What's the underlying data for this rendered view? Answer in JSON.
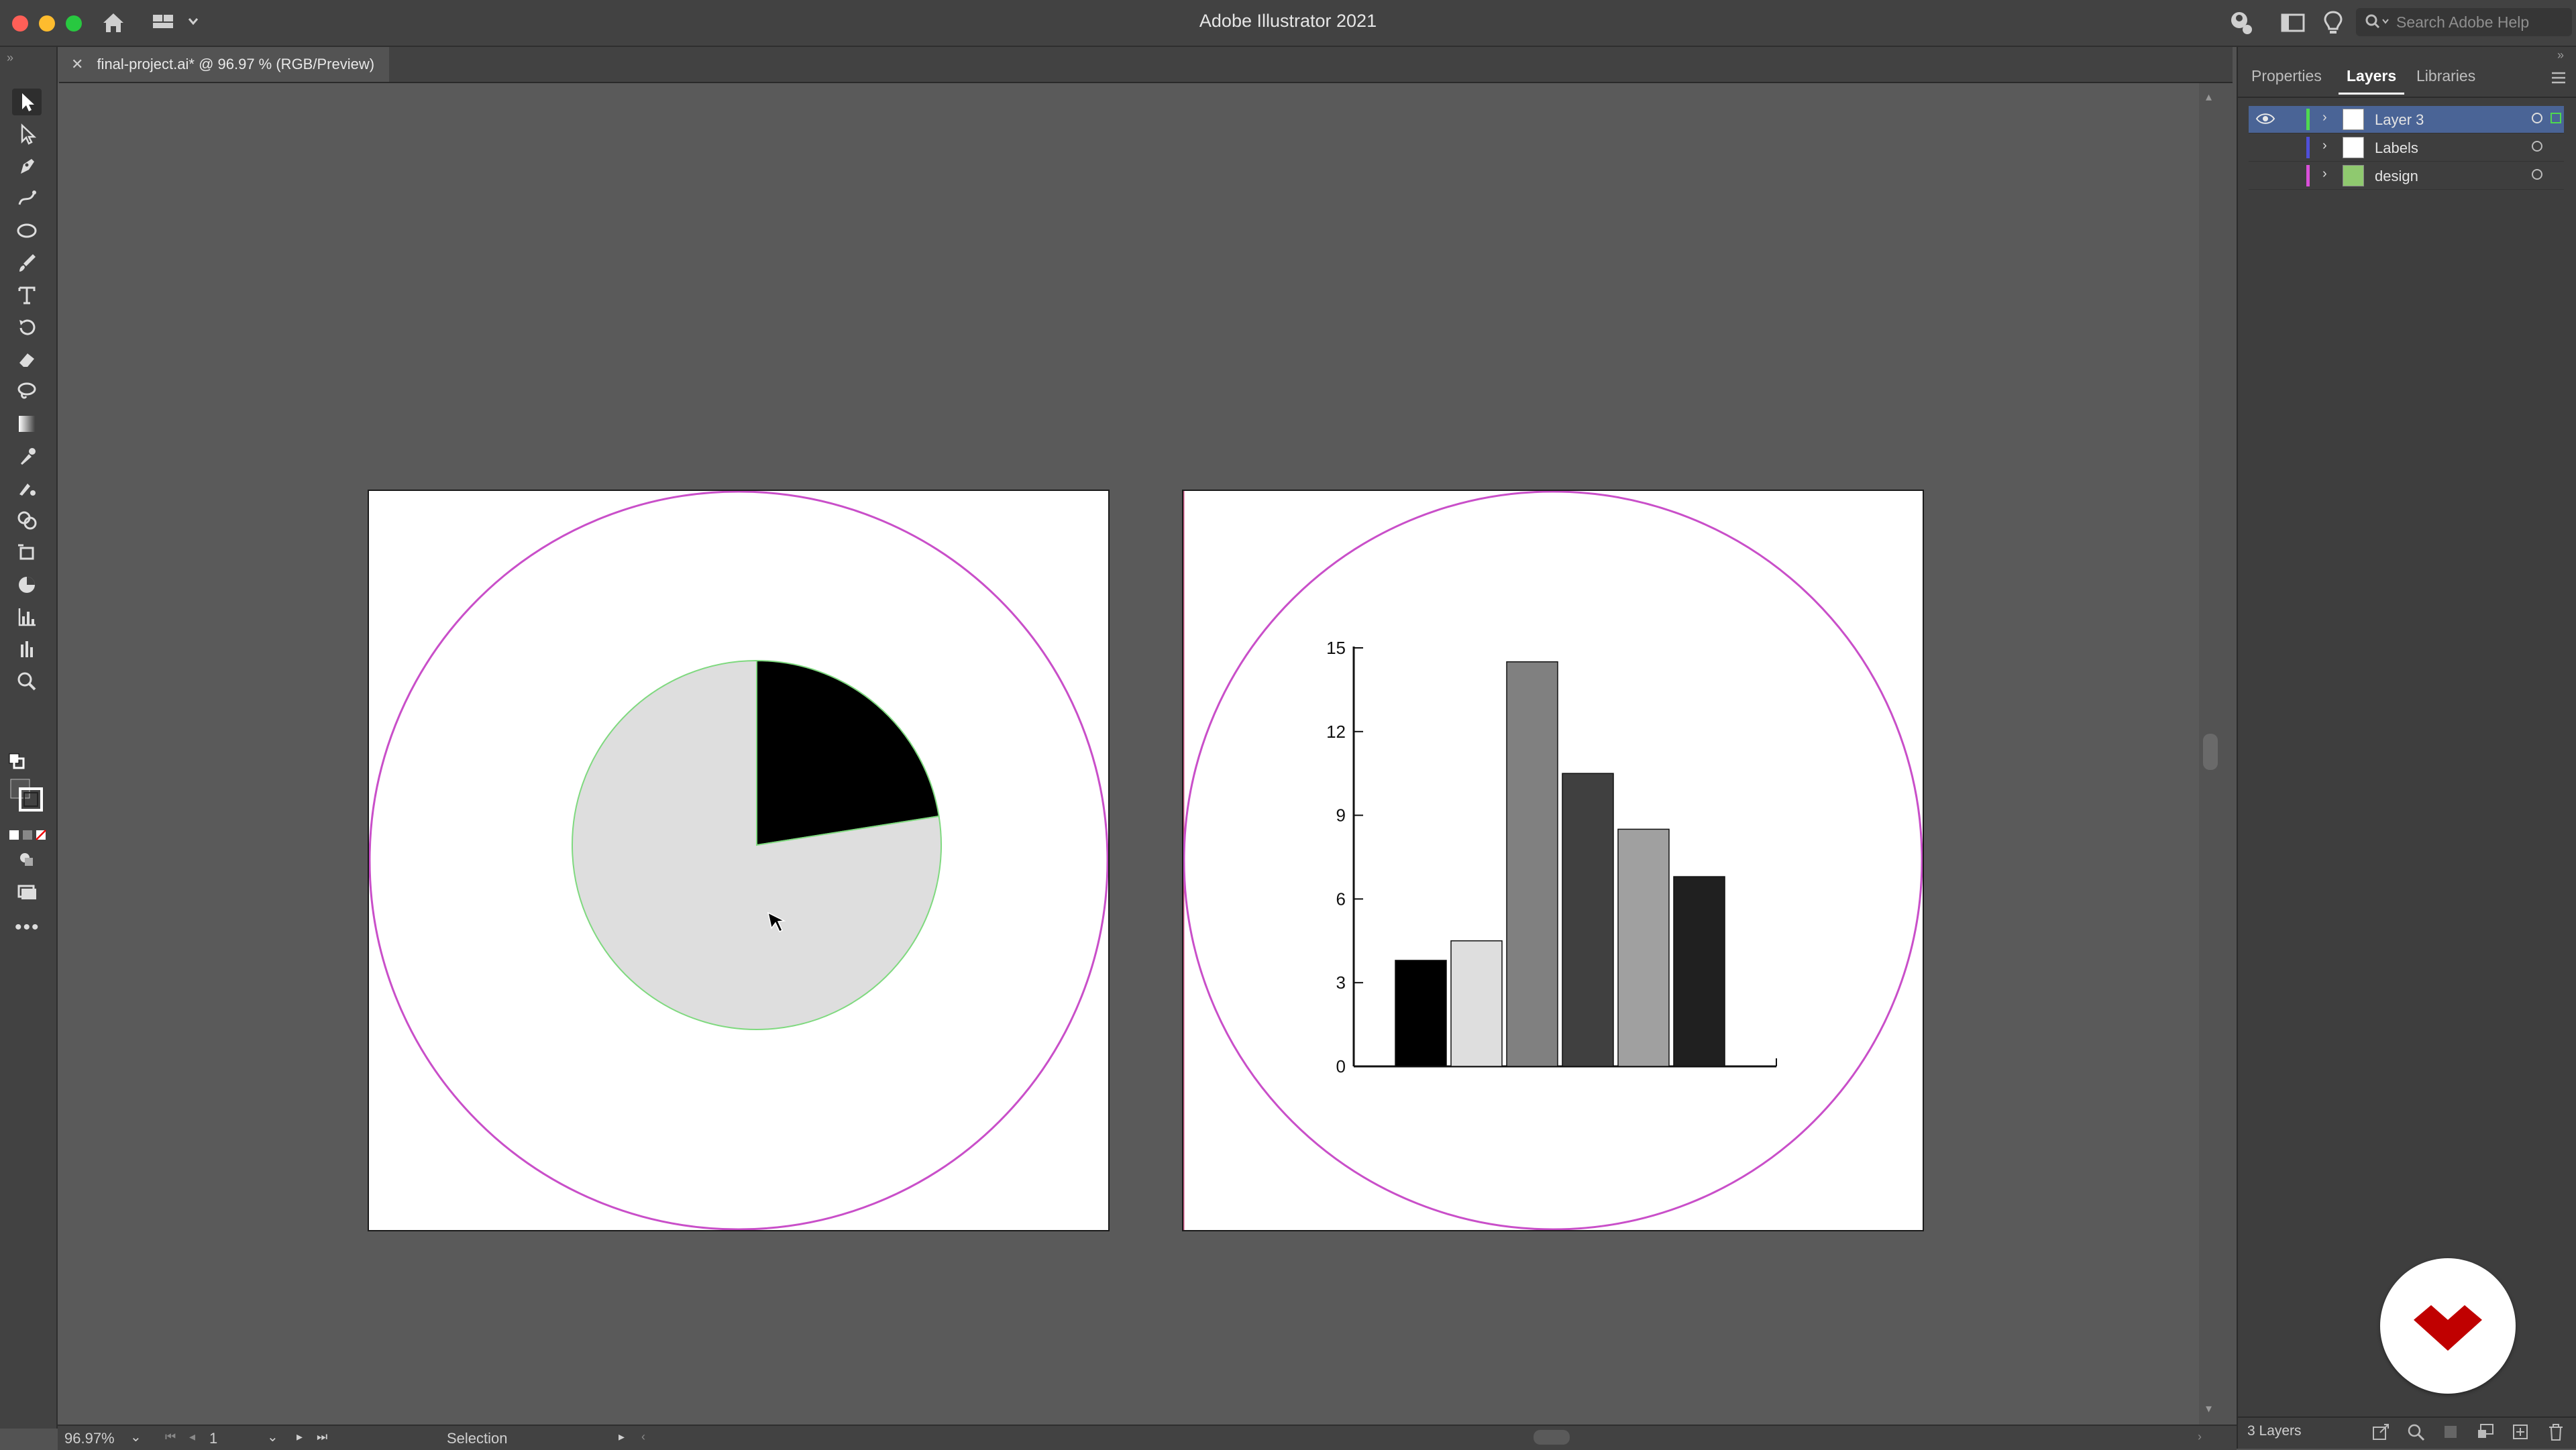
{
  "window": {
    "title": "Adobe Illustrator 2021",
    "search_placeholder": "Search Adobe Help"
  },
  "document": {
    "tab_title": "final-project.ai* @ 96.97 % (RGB/Preview)"
  },
  "panel": {
    "tabs": [
      "Properties",
      "Layers",
      "Libraries"
    ],
    "active_tab": "Layers",
    "layers": [
      {
        "name": "Layer 3",
        "color": "#4fd94f",
        "selected": true,
        "visible": true
      },
      {
        "name": "Labels",
        "color": "#4f4fd9",
        "selected": false,
        "visible": false
      },
      {
        "name": "design",
        "color": "#d94fd9",
        "selected": false,
        "visible": false
      }
    ],
    "footer_count": "3 Layers"
  },
  "status": {
    "zoom": "96.97%",
    "artboard_number": "1",
    "tool": "Selection"
  },
  "colors": {
    "guide_circle": "#c94fc9",
    "pie_outline": "#7fd97f",
    "selection_blue": "#4a6496",
    "logo_red": "#c00000"
  },
  "chart_data": [
    {
      "type": "pie",
      "slices": [
        {
          "label": "",
          "value": 22.5,
          "color": "#000000"
        },
        {
          "label": "",
          "value": 77.5,
          "color": "#dedede"
        }
      ]
    },
    {
      "type": "bar",
      "categories": [
        "",
        "",
        "",
        "",
        "",
        ""
      ],
      "values": [
        3.8,
        4.5,
        14.5,
        10.5,
        8.5,
        6.8
      ],
      "colors": [
        "#000000",
        "#dedede",
        "#808080",
        "#404040",
        "#a0a0a0",
        "#202020"
      ],
      "yticks": [
        "0",
        "3",
        "6",
        "9",
        "12",
        "15"
      ],
      "ylim": [
        0,
        15
      ]
    }
  ]
}
